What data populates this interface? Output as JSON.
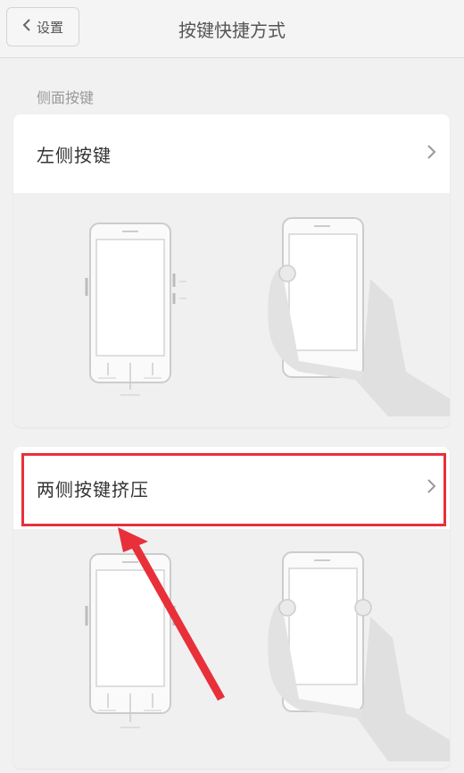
{
  "header": {
    "back_label": "设置",
    "title": "按键快捷方式"
  },
  "section": {
    "title": "侧面按键"
  },
  "options": [
    {
      "label": "左侧按键"
    },
    {
      "label": "两侧按键挤压"
    }
  ],
  "annotation": {
    "highlight_color": "#e8303a"
  },
  "icons": [
    "chevron-left-icon",
    "chevron-right-icon",
    "phone-illustration",
    "hand-holding-phone-illustration"
  ]
}
